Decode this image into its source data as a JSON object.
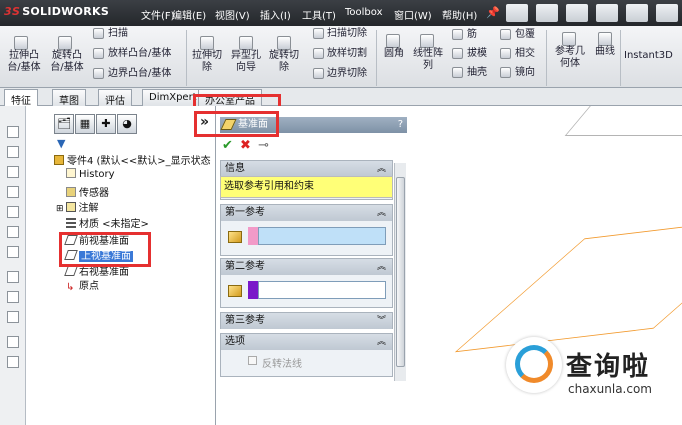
{
  "app": {
    "logo_text": "SOLIDWORKS",
    "logo_prefix": "3S"
  },
  "menubar": {
    "items": [
      "文件(F)",
      "编辑(E)",
      "视图(V)",
      "插入(I)",
      "工具(T)",
      "Toolbox",
      "窗口(W)",
      "帮助(H)"
    ]
  },
  "command_manager": {
    "group1": [
      {
        "label": "拉伸凸\n台/基体"
      },
      {
        "label": "旋转凸\n台/基体"
      },
      {
        "label": "扫描"
      },
      {
        "label": "放样凸台/基体"
      },
      {
        "label": "边界凸台/基体"
      }
    ],
    "group2": [
      {
        "label": "拉伸切\n除"
      },
      {
        "label": "异型孔\n向导"
      },
      {
        "label": "旋转切\n除"
      },
      {
        "label": "扫描切除"
      },
      {
        "label": "放样切割"
      },
      {
        "label": "边界切除"
      }
    ],
    "group3": [
      {
        "label": "圆角"
      },
      {
        "label": "线性阵\n列"
      },
      {
        "label": "筋"
      },
      {
        "label": "拔模"
      },
      {
        "label": "抽壳"
      },
      {
        "label": "包覆"
      },
      {
        "label": "相交"
      },
      {
        "label": "镜向"
      }
    ],
    "group4": [
      {
        "label": "参考几\n何体"
      },
      {
        "label": "曲线"
      },
      {
        "label": "Instant3D"
      }
    ]
  },
  "tabs": [
    "特征",
    "草图",
    "评估",
    "DimXpert",
    "办公室产品"
  ],
  "feature_tree": {
    "root": "零件4 (默认<<默认>_显示状态",
    "items": [
      {
        "label": "History",
        "icon": "history-icon"
      },
      {
        "label": "传感器",
        "icon": "sensor-icon"
      },
      {
        "label": "注解",
        "icon": "annotation-icon"
      },
      {
        "label": "材质 <未指定>",
        "icon": "material-icon"
      },
      {
        "label": "前视基准面",
        "icon": "plane-icon"
      },
      {
        "label": "上视基准面",
        "icon": "plane-icon",
        "selected": true
      },
      {
        "label": "右视基准面",
        "icon": "plane-icon"
      },
      {
        "label": "原点",
        "icon": "origin-icon"
      }
    ]
  },
  "property_manager": {
    "title": "基准面",
    "help": "?",
    "sections": {
      "info": {
        "title": "信息",
        "message": "选取参考引用和约束"
      },
      "first_ref": {
        "title": "第一参考",
        "swatch": "#f29ac8"
      },
      "second_ref": {
        "title": "第二参考",
        "swatch": "#7a18c9"
      },
      "third_ref": {
        "title": "第三参考"
      },
      "options": {
        "title": "选项",
        "flip_label": "反转法线"
      }
    }
  },
  "watermark": {
    "text": "查询啦",
    "url": "chaxunla.com"
  },
  "colors": {
    "accent": "#3a79d7",
    "highlight_box": "#e53030",
    "info_bg": "#ffff77",
    "plane": "#f29a2e"
  }
}
